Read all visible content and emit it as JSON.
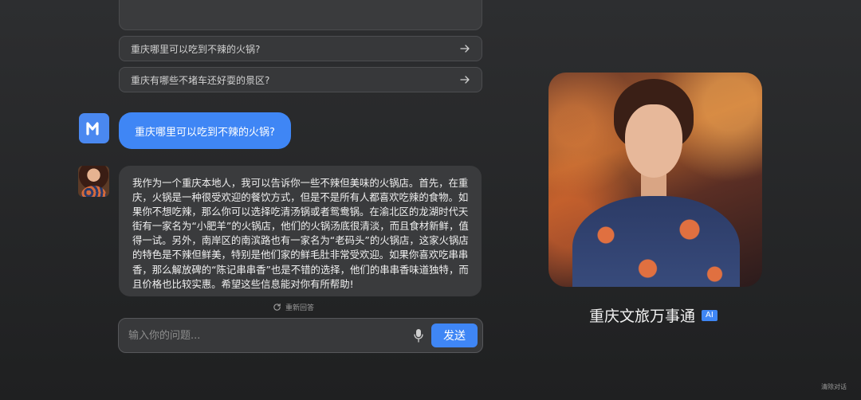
{
  "suggestions": [
    {
      "label": "重庆哪里可以吃到不辣的火锅?"
    },
    {
      "label": "重庆有哪些不堵车还好耍的景区?"
    }
  ],
  "conversation": {
    "user_message": "重庆哪里可以吃到不辣的火锅?",
    "ai_message": "我作为一个重庆本地人，我可以告诉你一些不辣但美味的火锅店。首先，在重庆，火锅是一种很受欢迎的餐饮方式，但是不是所有人都喜欢吃辣的食物。如果你不想吃辣，那么你可以选择吃清汤锅或者鸳鸯锅。在渝北区的龙湖时代天街有一家名为“小肥羊”的火锅店，他们的火锅汤底很清淡，而且食材新鲜，值得一试。另外，南岸区的南滨路也有一家名为“老码头”的火锅店，这家火锅店的特色是不辣但鲜美，特别是他们家的鲜毛肚非常受欢迎。如果你喜欢吃串串香，那么解放碑的“陈记串串香”也是不错的选择，他们的串串香味道独特，而且价格也比较实惠。希望这些信息能对你有所帮助!",
    "regenerate_label": "重新回答"
  },
  "input": {
    "placeholder": "输入你的问题...",
    "value": "",
    "send_label": "发送"
  },
  "agent": {
    "name": "重庆文旅万事通",
    "badge": "AI"
  },
  "footer": {
    "clear_label": "清除对话"
  },
  "colors": {
    "accent": "#3f86f5",
    "background": "#2a2b2d",
    "bubble": "#3a3b3d"
  }
}
